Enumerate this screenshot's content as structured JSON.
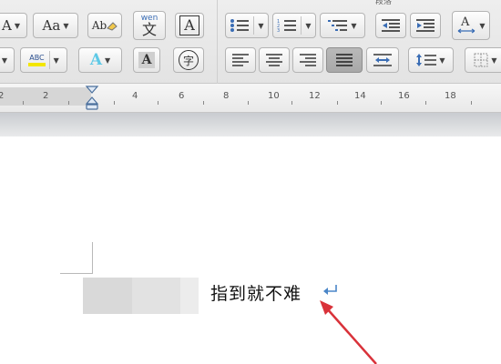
{
  "ribbon": {
    "group_title": "段落",
    "change_case_label": "Aa",
    "font_color_label": "A",
    "wen_label": "wen",
    "wen_char": "文",
    "boxed_char": "A",
    "shade_char": "A",
    "circle_char": "字",
    "spell_label": "Ab",
    "highlight_label": "ABC",
    "case_left_label": "A"
  },
  "ruler": {
    "labels": [
      "2",
      "2",
      "4",
      "6",
      "8",
      "10",
      "12",
      "14",
      "16",
      "18"
    ]
  },
  "document": {
    "text": "指到就不难"
  },
  "colors": {
    "accent": "#4a86c8",
    "arrow": "#d9323a"
  }
}
